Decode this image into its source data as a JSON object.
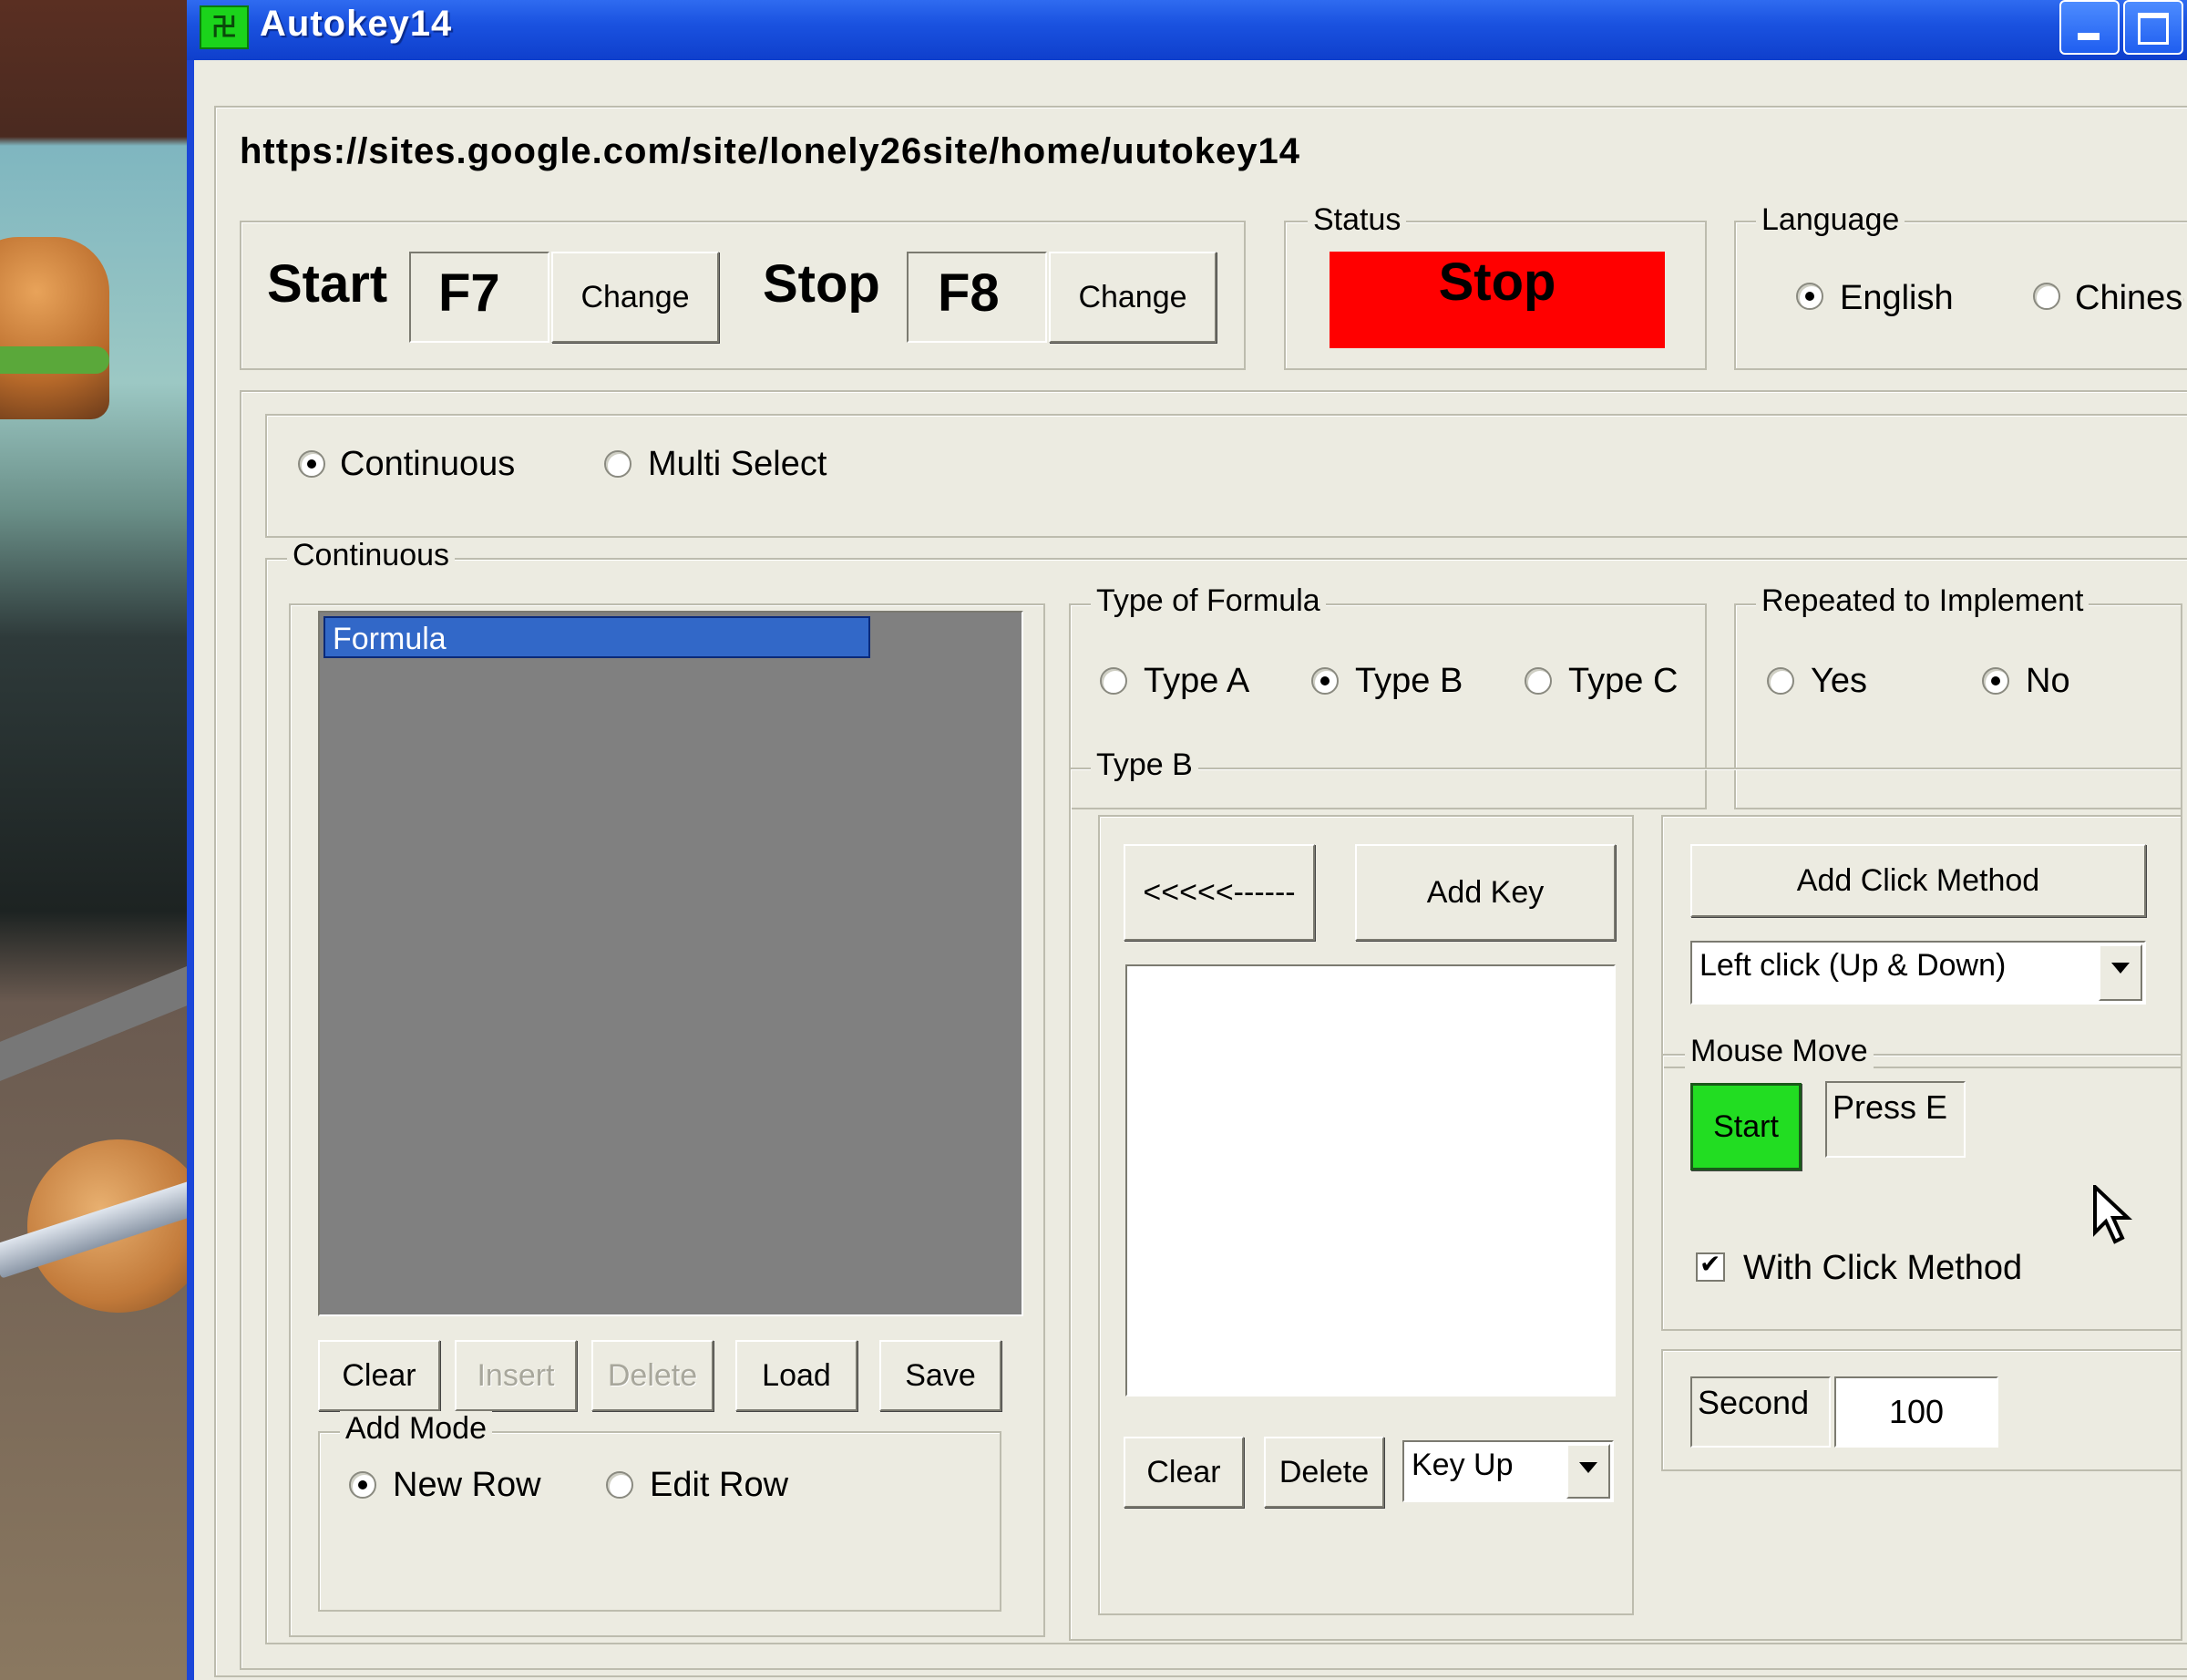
{
  "window": {
    "title": "Autokey14",
    "app_icon": "autokey-app-icon"
  },
  "url_text": "https://sites.google.com/site/lonely26site/home/uutokey14",
  "hotkeys": {
    "start_label": "Start",
    "start_key": "F7",
    "start_change": "Change",
    "stop_label": "Stop",
    "stop_key": "F8",
    "stop_change": "Change"
  },
  "status": {
    "legend": "Status",
    "value": "Stop",
    "color": "#ff0000"
  },
  "language": {
    "legend": "Language",
    "options": [
      "English",
      "Chinese"
    ],
    "selected": "English"
  },
  "mode": {
    "options": [
      "Continuous",
      "Multi Select"
    ],
    "selected": "Continuous"
  },
  "continuous": {
    "legend": "Continuous",
    "formula_list": {
      "items": [
        "Formula"
      ],
      "selected": "Formula"
    },
    "list_buttons": [
      "Clear",
      "Insert",
      "Delete",
      "Load",
      "Save"
    ],
    "list_buttons_disabled": [
      "Insert",
      "Delete"
    ],
    "add_mode": {
      "legend": "Add Mode",
      "options": [
        "New Row",
        "Edit Row"
      ],
      "selected": "New Row"
    }
  },
  "type_of_formula": {
    "legend": "Type of Formula",
    "options": [
      "Type A",
      "Type B",
      "Type C"
    ],
    "selected": "Type B"
  },
  "repeated": {
    "legend": "Repeated to Implement",
    "options": [
      "Yes",
      "No"
    ],
    "selected": "No"
  },
  "type_b": {
    "legend": "Type B",
    "back_button": "<<<<<------",
    "add_key_button": "Add Key",
    "clear_button": "Clear",
    "delete_button": "Delete",
    "key_event_select": "Key Up"
  },
  "click_method": {
    "add_button": "Add Click Method",
    "select_value": "Left click (Up & Down)"
  },
  "mouse_move": {
    "legend": "Mouse Move",
    "start_button": "Start",
    "start_color": "#22dd22",
    "hint": "Press E",
    "with_click_checkbox": "With Click Method",
    "with_click_checked": true
  },
  "timing": {
    "label": "Second",
    "value": "100"
  }
}
